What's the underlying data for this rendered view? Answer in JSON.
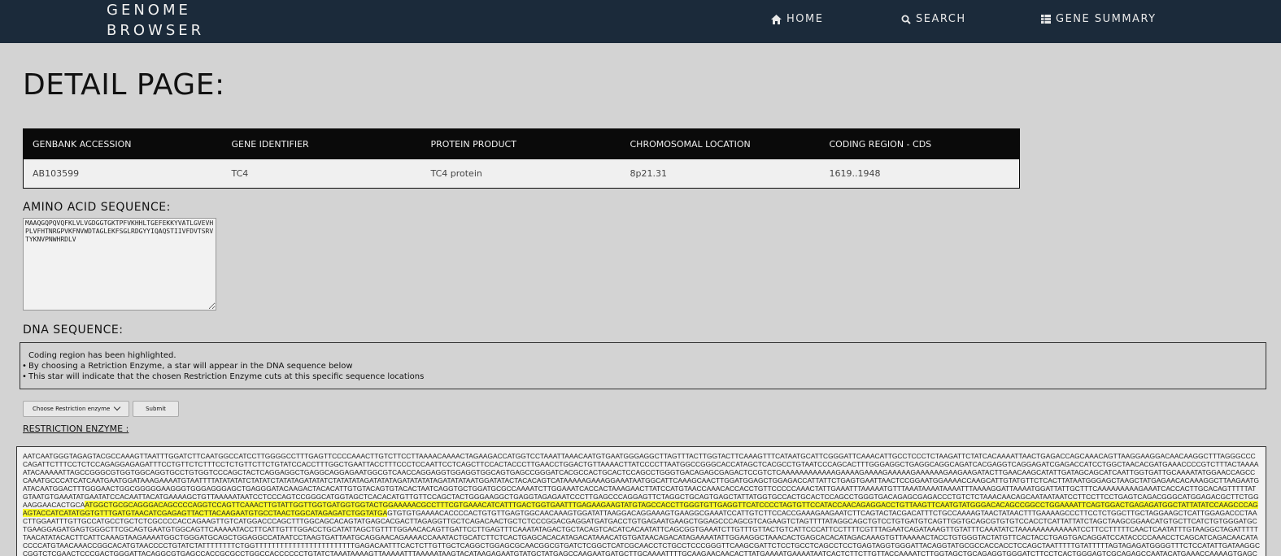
{
  "nav": {
    "brand_line1": "GENOME",
    "brand_line2": "BROWSER",
    "home": "HOME",
    "search": "SEARCH",
    "gene_summary": "GENE SUMMARY"
  },
  "page_title": "DETAIL PAGE:",
  "table": {
    "headers": [
      "GENBANK ACCESSION",
      "GENE IDENTIFIER",
      "PROTEIN PRODUCT",
      "CHROMOSOMAL LOCATION",
      "CODING REGION - CDS"
    ],
    "row": [
      "AB103599",
      "TC4",
      "TC4 protein",
      "8p21.31",
      "1619..1948"
    ]
  },
  "amino_label": "AMINO ACID SEQUENCE:",
  "amino_sequence": "MAAQGQPQVQFKLVLVGDGGTGKTPFVKHHLTGEFEKKYVATLGVEVHPLVFHTNRGPVKFNVWDTAGLEKFSGLRDGYYIQAQSTIIVFDVTSRVTYKNVPNWHRDLV",
  "dna_label": "DNA SEQUENCE:",
  "info": {
    "line1": "Coding region has been highlighted.",
    "line2": "By choosing a Retriction Enzyme, a star will appear in the DNA sequence below",
    "line3": "This star will indicate that the chosen Restriction Enzyme cuts at this specific sequence locations"
  },
  "controls": {
    "select_value": "Choose Restriction enzyme",
    "submit_label": "Submit"
  },
  "restriction_label": "RESTRICTION ENZYME :",
  "dna": {
    "before": "AATCAATGGGTAGAGTACGCCAAAGTTAATTTGGATCTTCAATGGCCATCCTTGGGGCCTTTGAGTTCCCCAAACTTGTCTTCCTTAAAACAAAACTAGAAGACCATGGTCCTAAATTAAACAATGTGAATGGGAGGCTTAGTTTACTTGGTACTTCAAAGTTTCATAATGCATTCGGGATTCAAACATTGCCTCCCTCTAAGATTCTATCACAAAATTAACTGAGACCAGCAAACAGTTAAGGAAGGACAACAAGGCTTTAGGGCCCCAGATTCTTTCCTCTCCAGAGGAGAGATTTCCTGTTCTCTTTCCTCTGTTCTTCTGTATCCACCTTTGGCTGAATTACCTTTCCCTCCAATTCCTCAGCTTCCACTACCCTTGAACCTGGACTGTTAAAACTTATCCCCTTAATGGCCGGGCACCATAGCTCACGCCTGTAATCCCAGCACTTTGGGAGGCTGAGGCAGGCAGATCACGAGGTCAGGAGATCGAGACCATCCTGGCTAACACGATGAAACCCCGTCTTTACTAAAAATACAAAAATTAGCCGGGCGTGGTGGCAGGTGCCTGTGGTCCCAGCTACTCAGGAGGCTGAGGCAGGAGAATGGCGTCAACCAGGAGGTGGAGGTGGCAGTGAGCCGGGATCACGCCACTGCACTCCAGCCTGGGTGACAGAGCGAGACTCCGTCTCAAAAAAAAAAAAGAAAAGAAAAGAAAAAGAAAAAAGAAGAAGATACTTGAACAAGCATATTGATAGCAGCATCAATTGGTGATTGCAAAATATGGAACCAGCCCAAATGCCCATCATCAATGAATGGATAAAGAAAATGTAATTTTATATATATCTATATCTATATAGATATATCTATATATAGATATATAGATATATATAGATATATAATGGATATACTACACAGTCATAAAAAGAAAGGAAATAATGGCATTCAAAGCAACTTGGATGGAGCTGGAGACCATTATTCTGAGTGAATTAACTCCGGAATGGAAAACCAAGCATTGTATGTTCTCACTTATAATGGGAGCTAAGCTATGAGAACACAAAGGCTTAAGAATGATACAATGGACTTTGGGAACTGGCGGGGGAAGGGTGGGAGGGAGCTGAGGGATACAAGACTACACATTGTGTACAGTGTACACTAATCAGGTGCTGGATGCGCCAAAATCTTGGAAATCACCACTAAAGAACTTATCCATGTAACCAAACACCACCTGTTCCCCCAAACTATTGAAATTTAAAAATGTTTAAATAAAATAAAATTTAAAAGGATTAAAATGGATTATTGCTTTCAAAAAAAAAGAAATCACCACTTGCACAGTTTTTATGTAATGTGAAATATGAATATCCACAATTACATGAAAAGCTGTTAAAAATAATCCTCCCAGTCCGGGCATGGTAGCTCACACATGTTGTTCCAGCTACTGGGAAGGCTGAGGTAGAGAATCCCTTGAGCCCAGGAGTTCTAGGCTGCAGTGAGCTATTATGGTGCCACTGCACTCCAGCCTGGGTGACAGAGCGAGACCCTGTCTCTAAACAACAGCAATAATAATCCTTCCTTCCTGAGTCAGACGGGCATGGAGACGCTTCTGGAAGGAACACTGCA",
    "highlight": "ATGGCTGCGCAGGGACAGCCCCAGGTCCAGTTCAAACTTGTATTGGTTGGTGATGGTGGTACTGGAAAAACGCCTTTCGTGAAACATCATTTGACTGGTGAATTTGAGAAGAAGTATGTAGCCACCTTGGGTGTTGAGGTTCATCCCCTAGTGTTCCATACCAACAGAGGACCTGTTAAGTTCAATGTATGGGACACAGCCGGCCTGGAAAATTCAGTGGACTGAGAGATGGCTATTATATCCAAGCCCAGAGTACCATCATATGGTGTTTGATGTAACATCGAGAGTTACTTACAAGAATGTGCCTAACTGGCATAGAGATCTGGTATGA",
    "after": "GTGTGTGAAAACACCCCACTGTGTTGAGTGGCAACAAAGTGGATATTAAGGACAGGAAAGTGAAGGCGAAATCCATTGTCTTCCACCGAAAGAAGAATCTTCAGTACTACGACATTTCTGCCAAAAGTAACTATAACTTTGAAAAGCCCTTCCTCTGGCTTGCTAGGAAGCTCATTGGAGACCCTAACTTGGAATTTGTTGCCATGCCTGCTCTCGCCCCACCAGAAGTTGTCATGGACCCAGCTTTGGCAGCACAGTATGAGCACGACTTAGAGGTTGCTCAGACAACTGCTCTCCCGGACGAGGATGATGACCTGTGAGAATGAAGCTGGAGCCCAGCGTCAGAAGTCTAGTTTTATAGGCAGCTGTCCTGTGATGTCAGTTGGTGCAGCGTGTGTCCACCTCATTATTATCTAGCTAAGCGGAACATGTGCTTCATCTGTGGGATGCTGAAGGAGATGAGTGGGCTTCGCAGTGAATGTGGCAGTTCAAAAATACCTTCATTGTTTGGACCTGCATATTAGCTGTTTTGGAACACAGTTGATTCCTTGAGTTTCAAATATAGACTGCTACAGTCACATCACAATATTCAGCGGTGAAATCTTGTTTGTTACTGTCATTCCCATTCCTTTTCGTTTAGAATCAGATAAAGTTGTATTTCAAATATCTAAAAAAAAAAAAATCCTTCCTTTTTCAACTCAATATTTGTAAGGCTAGATTTTTTAACATATACACTTCATTCAAAGTAAGAAAATGGCTGGGATGCAGCTGGAGGCCATAATCCTAAGTGATTAATGCAGGAACAGAAAACCAAATACTGCATCTTCTCACTGAGCACACATAGACATAAACATGTGATAACAGACATAGAAAATATTGGAAGGCTAAACACTGAGCACACATAGACAAAGTGTTAAAAACTACCTGTGGGTACTATGTTCACTACCTGAGTGACAGGATCCATACCCCAAACCTCAGCATCAGACAACATACCCCATGTAACAAACCGGCACATGTAACCCCTGTATCTATTTTTTTTCTGGTTTTTTTTTTTTTTTTTTTTTTTTGAGACAATTTCACTCTTGTTGCTCAGGCTGGAGCGCAACGGCGTGATCTCGGCTCATCGCAACCTCTGCCTCCCGGGTTCAAGCGATTCTCCTGCCTCAGCCTCCTGAGTAGGTGGGATTACAGGTATGCGCCACCACCTCCAGCTAATTTTTGTATTTTTAGTAGAGATGGGGTTTCTCCATATTGATAAGGCCGGTCTCGAACTCCCGACTGGGATTACAGGCGTGAGCCACCGCGCCTGGCCACCCCCCTGTATCTAAATAAAAGTTAAAAATTTAAAAATAAGTACATAAGAGAATGTATGCTATGAGCCAAGAATGATGCTTGCAAAATTTTGCAAGAACAACACTTATGAAAATGAAAATAATCACTCTTCTTGTTACCAAAATCTTGGTAGCTGCAGAGGTGGGATCTTCCTCACTGGGAGTCGCAGAGCCAATACATGAAACCAAAAGTGAGCCTTAAGCAGAGCAAGCTTTTATTTCCTGCACAGGACTTGTAAAGAGGAGACAGCTCTGCCAAGTCAAACTTCTCCACTAGTGAGGCGGCTAGTGAGGGGTGAGGGGGGTAAAATGTAGGAT"
  }
}
